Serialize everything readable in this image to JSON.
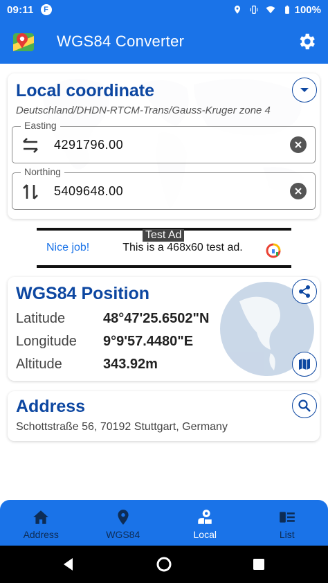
{
  "status_bar": {
    "time": "09:11",
    "left_icon": "notification-f-icon",
    "right_icons": [
      "location-icon",
      "vibrate-icon",
      "wifi-icon",
      "battery-icon"
    ],
    "battery": "100%"
  },
  "app_bar": {
    "title": "WGS84 Converter",
    "logo_icon": "map-pin-logo-icon",
    "settings_icon": "gear-icon"
  },
  "local_card": {
    "title": "Local coordinate",
    "system": "Deutschland/DHDN-RTCM-Trans/Gauss-Kruger zone 4",
    "dropdown_icon": "chevron-down-icon",
    "easting": {
      "label": "Easting",
      "value": "4291796.00",
      "icon": "swap-horizontal-icon"
    },
    "northing": {
      "label": "Northing",
      "value": "5409648.00",
      "icon": "swap-vertical-icon"
    }
  },
  "ad": {
    "tag": "Test Ad",
    "headline": "Nice job!",
    "text": "This is a 468x60 test ad."
  },
  "wgs_card": {
    "title": "WGS84 Position",
    "latitude_label": "Latitude",
    "latitude_value": "48°47'25.6502\"N",
    "longitude_label": "Longitude",
    "longitude_value": "9°9'57.4480\"E",
    "altitude_label": "Altitude",
    "altitude_value": "343.92m"
  },
  "address_card": {
    "title": "Address",
    "address": "Schottstraße 56, 70192 Stuttgart, Germany"
  },
  "bottom_nav": {
    "items": [
      {
        "label": "Address",
        "icon": "home-icon",
        "active": false
      },
      {
        "label": "WGS84",
        "icon": "location-pin-icon",
        "active": false
      },
      {
        "label": "Local",
        "icon": "local-user-pin-icon",
        "active": true
      },
      {
        "label": "List",
        "icon": "list-icon",
        "active": false
      }
    ]
  },
  "colors": {
    "primary": "#1a73e8",
    "title_blue": "#0d47a1"
  }
}
